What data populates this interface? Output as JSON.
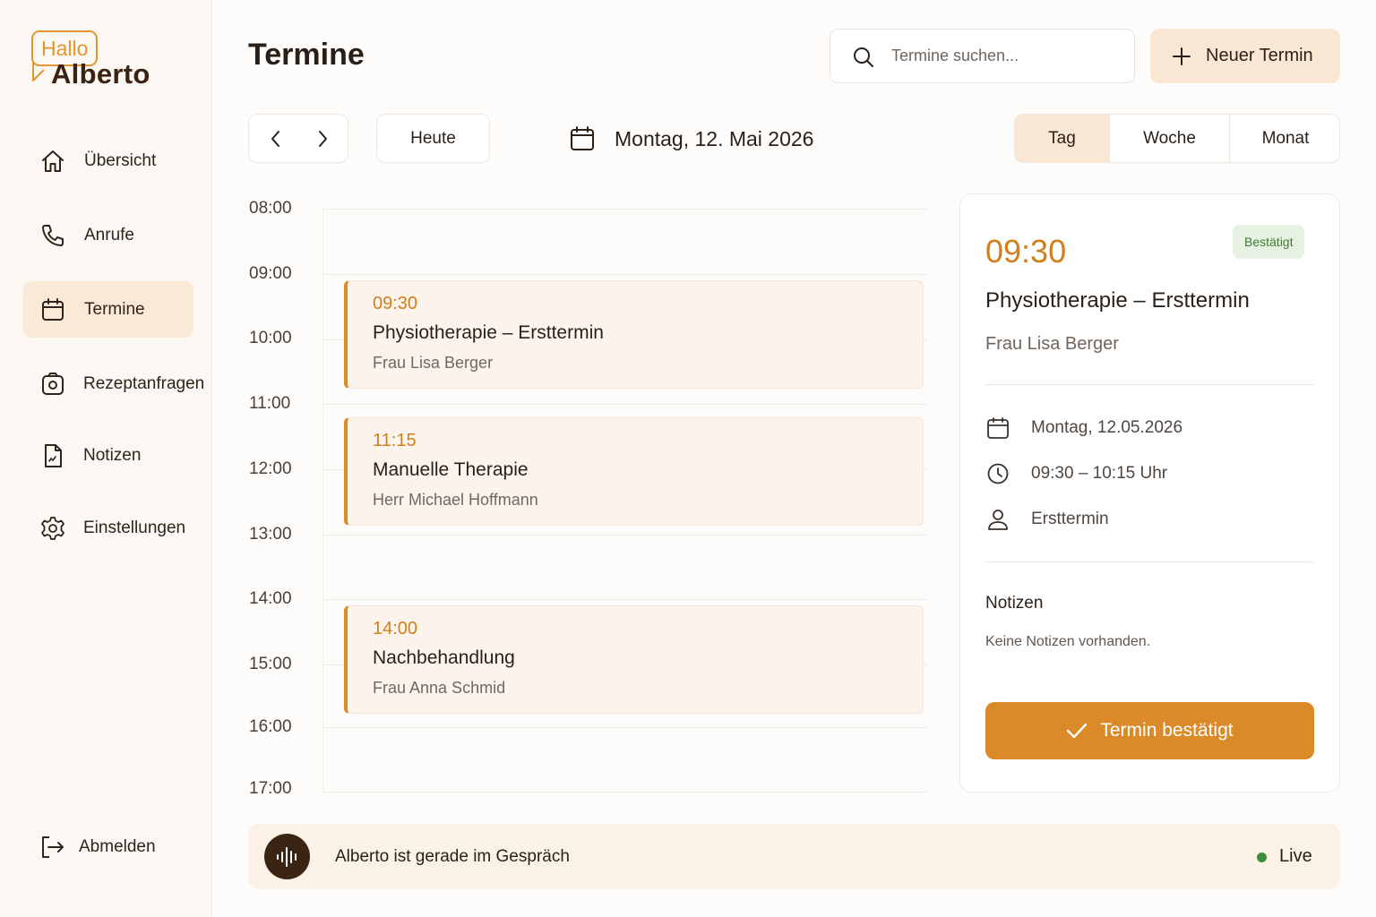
{
  "brand": {
    "hallo": "Hallo",
    "name": "Alberto",
    "accent": "#db8a2a"
  },
  "sidebar": {
    "items": [
      {
        "label": "Übersicht",
        "icon": "home-icon"
      },
      {
        "label": "Anrufe",
        "icon": "phone-icon"
      },
      {
        "label": "Termine",
        "icon": "calendar-icon",
        "active": true
      },
      {
        "label": "Rezeptanfragen",
        "icon": "prescription-icon"
      },
      {
        "label": "Notizen",
        "icon": "document-icon"
      },
      {
        "label": "Einstellungen",
        "icon": "gear-icon"
      }
    ],
    "logout": {
      "label": "Abmelden",
      "icon": "logout-icon"
    }
  },
  "header": {
    "title": "Termine",
    "search_placeholder": "Termine suchen...",
    "new_button": "Neuer Termin"
  },
  "toolbar": {
    "today": "Heute",
    "current_date": "Montag, 12. Mai 2026",
    "views": [
      "Tag",
      "Woche",
      "Monat"
    ],
    "active_view": "Tag"
  },
  "timeline": {
    "hours": [
      "08:00",
      "09:00",
      "10:00",
      "11:00",
      "12:00",
      "13:00",
      "14:00",
      "15:00",
      "16:00",
      "17:00"
    ],
    "appointments": [
      {
        "time": "09:30",
        "title": "Physiotherapie – Ersttermin",
        "patient": "Frau Lisa Berger"
      },
      {
        "time": "11:15",
        "title": "Manuelle Therapie",
        "patient": "Herr Michael Hoffmann"
      },
      {
        "time": "14:00",
        "title": "Nachbehandlung",
        "patient": "Frau Anna Schmid"
      }
    ]
  },
  "detail": {
    "time": "09:30",
    "status": "Bestätigt",
    "title": "Physiotherapie – Ersttermin",
    "patient": "Frau Lisa Berger",
    "date": "Montag, 12.05.2026",
    "duration": "09:30 – 10:15 Uhr",
    "type": "Ersttermin",
    "notes_heading": "Notizen",
    "notes": "Keine Notizen vorhanden.",
    "confirm_button": "Termin bestätigt"
  },
  "call_bar": {
    "text": "Alberto ist gerade im Gespräch",
    "status": "Live",
    "status_color": "#3f8f3a"
  }
}
